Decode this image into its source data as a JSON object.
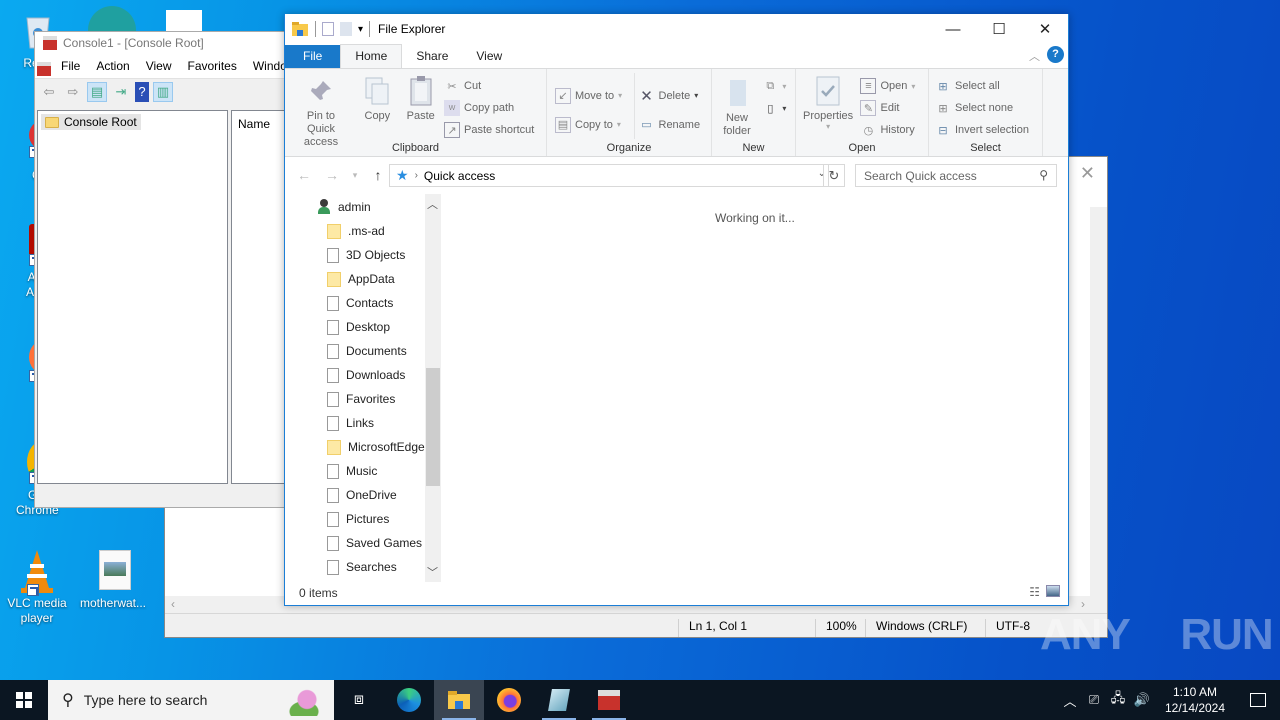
{
  "desktop": {
    "icons": [
      {
        "label": "Recycle Bin",
        "visible_label": "Recy"
      },
      {
        "label": "CCleaner",
        "visible_label": "CCl"
      },
      {
        "label": "Adobe Acrobat",
        "visible_label": "Ad Acr"
      },
      {
        "label": "Firefox",
        "visible_label": "Fir"
      },
      {
        "label": "Google Chrome",
        "visible_label": "Go Chrome"
      },
      {
        "label": "VLC media player"
      },
      {
        "label": "motherwat..."
      }
    ],
    "watermark": "ANY RUN"
  },
  "mmc": {
    "title": "Console1 - [Console Root]",
    "menu": [
      "File",
      "Action",
      "View",
      "Favorites",
      "Windo"
    ],
    "tree_root": "Console Root",
    "column_header": "Name"
  },
  "notepad": {
    "status": {
      "position": "Ln 1, Col 1",
      "zoom": "100%",
      "line_ending": "Windows (CRLF)",
      "encoding": "UTF-8"
    }
  },
  "explorer": {
    "title": "File Explorer",
    "tabs": {
      "file": "File",
      "home": "Home",
      "share": "Share",
      "view": "View"
    },
    "ribbon": {
      "clipboard": {
        "name": "Clipboard",
        "pin": "Pin to Quick access",
        "copy": "Copy",
        "paste": "Paste",
        "cut": "Cut",
        "copy_path": "Copy path",
        "paste_shortcut": "Paste shortcut"
      },
      "organize": {
        "name": "Organize",
        "move_to": "Move to",
        "copy_to": "Copy to",
        "delete": "Delete",
        "rename": "Rename"
      },
      "new": {
        "name": "New",
        "new_folder": "New folder"
      },
      "open": {
        "name": "Open",
        "properties": "Properties",
        "open": "Open",
        "edit": "Edit",
        "history": "History"
      },
      "select": {
        "name": "Select",
        "select_all": "Select all",
        "select_none": "Select none",
        "invert": "Invert selection"
      }
    },
    "address": {
      "location": "Quick access"
    },
    "search": {
      "placeholder": "Search Quick access"
    },
    "nav": {
      "root": "admin",
      "items": [
        {
          "label": ".ms-ad",
          "type": "folder"
        },
        {
          "label": "3D Objects",
          "type": "file"
        },
        {
          "label": "AppData",
          "type": "folder"
        },
        {
          "label": "Contacts",
          "type": "file"
        },
        {
          "label": "Desktop",
          "type": "file"
        },
        {
          "label": "Documents",
          "type": "file"
        },
        {
          "label": "Downloads",
          "type": "file"
        },
        {
          "label": "Favorites",
          "type": "file"
        },
        {
          "label": "Links",
          "type": "file"
        },
        {
          "label": "MicrosoftEdge",
          "type": "folder"
        },
        {
          "label": "Music",
          "type": "file"
        },
        {
          "label": "OneDrive",
          "type": "file"
        },
        {
          "label": "Pictures",
          "type": "file"
        },
        {
          "label": "Saved Games",
          "type": "file"
        },
        {
          "label": "Searches",
          "type": "file"
        }
      ]
    },
    "content_status": "Working on it...",
    "status_bar": "0 items"
  },
  "taskbar": {
    "search_placeholder": "Type here to search",
    "apps": [
      "Task View",
      "Microsoft Edge",
      "File Explorer",
      "Firefox",
      "Notepad",
      "MMC"
    ],
    "time": "1:10 AM",
    "date": "12/14/2024"
  }
}
